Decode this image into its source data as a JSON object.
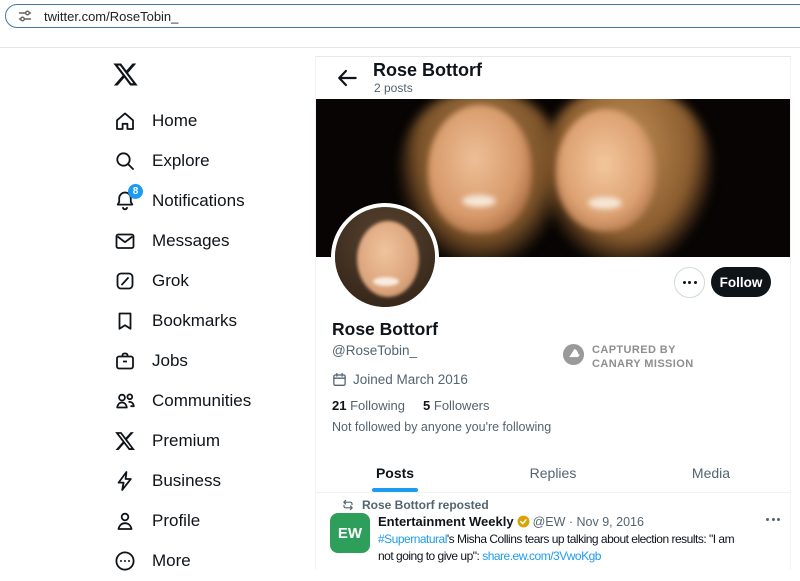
{
  "browser": {
    "url": "twitter.com/RoseTobin_"
  },
  "sidebar": {
    "items": [
      {
        "label": "Home",
        "icon": "home-icon"
      },
      {
        "label": "Explore",
        "icon": "search-icon"
      },
      {
        "label": "Notifications",
        "icon": "bell-icon",
        "badge": "8"
      },
      {
        "label": "Messages",
        "icon": "envelope-icon"
      },
      {
        "label": "Grok",
        "icon": "grok-icon"
      },
      {
        "label": "Bookmarks",
        "icon": "bookmark-icon"
      },
      {
        "label": "Jobs",
        "icon": "briefcase-icon"
      },
      {
        "label": "Communities",
        "icon": "people-icon"
      },
      {
        "label": "Premium",
        "icon": "x-icon"
      },
      {
        "label": "Business",
        "icon": "bolt-icon"
      },
      {
        "label": "Profile",
        "icon": "person-icon"
      },
      {
        "label": "More",
        "icon": "more-circle-icon"
      }
    ]
  },
  "header": {
    "title": "Rose Bottorf",
    "subtitle": "2 posts"
  },
  "profile": {
    "name": "Rose Bottorf",
    "handle": "@RoseTobin_",
    "joined": "Joined March 2016",
    "following_count": "21",
    "following_label": "Following",
    "followers_count": "5",
    "followers_label": "Followers",
    "follow_note": "Not followed by anyone you're following",
    "follow_button": "Follow",
    "watermark_line1": "CAPTURED BY",
    "watermark_line2": "CANARY MISSION"
  },
  "tabs": [
    {
      "label": "Posts",
      "active": true
    },
    {
      "label": "Replies",
      "active": false
    },
    {
      "label": "Media",
      "active": false
    }
  ],
  "post": {
    "repost_note": "Rose Bottorf reposted",
    "author": "Entertainment Weekly",
    "avatar_text": "EW",
    "meta": "@EW · Nov 9, 2016",
    "body_parts": [
      {
        "text": "#Supernatural",
        "type": "link"
      },
      {
        "text": "'s Misha Collins tears up talking about election results: \"I am",
        "type": "plain"
      },
      {
        "text": "not going to give up\": ",
        "type": "plain"
      },
      {
        "text": "share.ew.com/3VwoKgb",
        "type": "link"
      }
    ]
  },
  "colors": {
    "accent": "#1d9bf0",
    "text": "#0f1419",
    "gray": "#536471",
    "border": "#eff3f4",
    "ew_green": "#2e9e5b",
    "gold": "#d9a40a",
    "watermark": "#8e8e8e",
    "omnibox_border": "#4678a8"
  }
}
